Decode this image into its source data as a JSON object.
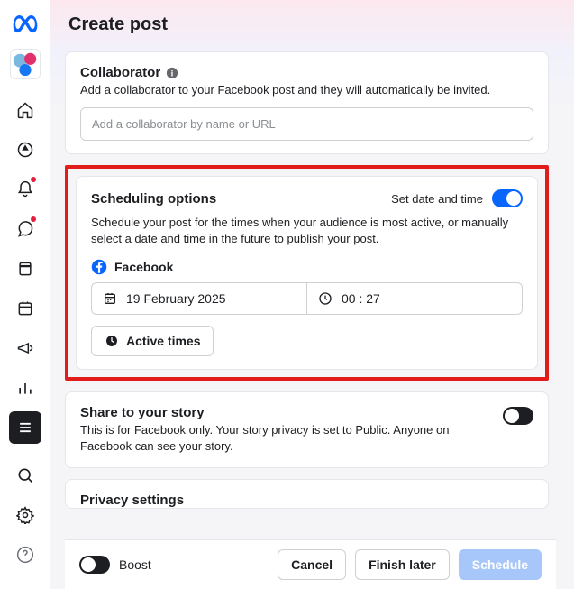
{
  "page": {
    "title": "Create post"
  },
  "collaborator": {
    "title": "Collaborator",
    "desc": "Add a collaborator to your Facebook post and they will automatically be invited.",
    "placeholder": "Add a collaborator by name or URL"
  },
  "scheduling": {
    "title": "Scheduling options",
    "toggle_label": "Set date and time",
    "enabled": true,
    "desc": "Schedule your post for the times when your audience is most active, or manually select a date and time in the future to publish your post.",
    "platform": "Facebook",
    "date": "19 February 2025",
    "time": "00 : 27",
    "active_times": "Active times"
  },
  "story": {
    "title": "Share to your story",
    "desc": "This is for Facebook only. Your story privacy is set to Public. Anyone on Facebook can see your story."
  },
  "privacy": {
    "title": "Privacy settings"
  },
  "footer": {
    "boost": "Boost",
    "cancel": "Cancel",
    "finish_later": "Finish later",
    "schedule": "Schedule"
  }
}
